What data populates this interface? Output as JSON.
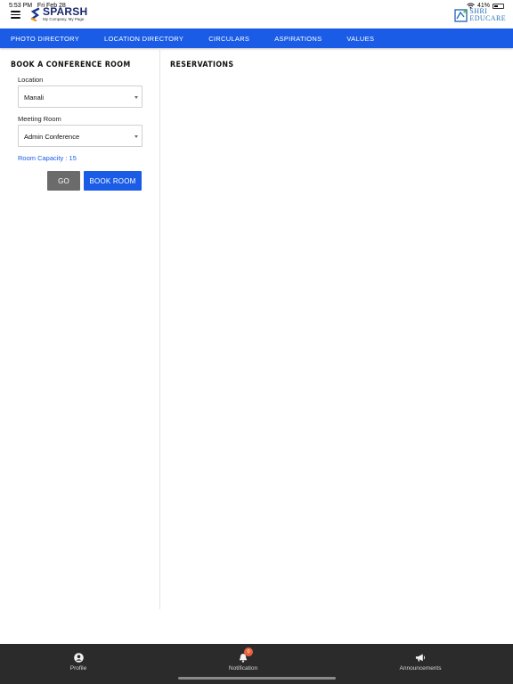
{
  "status": {
    "time": "5:53 PM",
    "date": "Fri Feb 28",
    "battery": "41%"
  },
  "app": {
    "logo_title": "SPARSH",
    "logo_tagline": "My Company. My Page.",
    "brand_line1": "SHRI",
    "brand_line2": "EDUCARE"
  },
  "nav": {
    "items": [
      "PHOTO DIRECTORY",
      "LOCATION DIRECTORY",
      "CIRCULARS",
      "ASPIRATIONS",
      "VALUES"
    ]
  },
  "booking": {
    "title": "BOOK A CONFERENCE ROOM",
    "location_label": "Location",
    "location_value": "Manali",
    "room_label": "Meeting Room",
    "room_value": "Admin Conference",
    "capacity_text": "Room Capacity : 15",
    "go_label": "GO",
    "book_label": "BOOK ROOM"
  },
  "reservations": {
    "title": "RESERVATIONS"
  },
  "bottom_tabs": {
    "profile": "Profile",
    "notification": "Notification",
    "notification_count": "0",
    "announcements": "Announcements"
  },
  "colors": {
    "primary": "#1a5ce6",
    "go_button": "#6b6b6b",
    "tabbar": "#2b2b2b",
    "badge": "#e8603c"
  }
}
